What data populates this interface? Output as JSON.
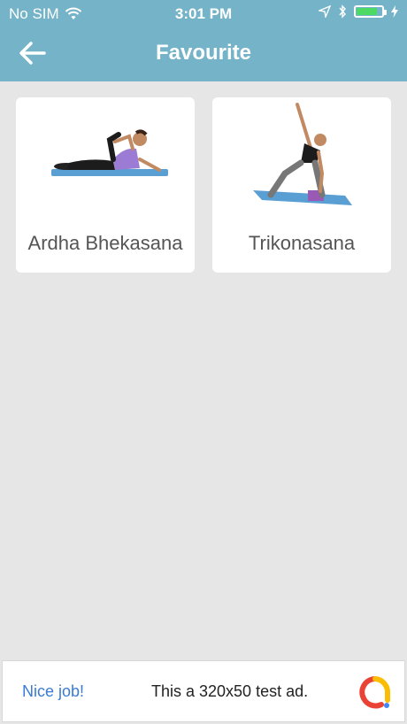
{
  "status": {
    "carrier": "No SIM",
    "time": "3:01 PM"
  },
  "header": {
    "title": "Favourite"
  },
  "favourites": [
    {
      "name": "Ardha Bhekasana",
      "image": "yoga-pose-lying-image"
    },
    {
      "name": "Trikonasana",
      "image": "yoga-pose-triangle-image"
    }
  ],
  "ad": {
    "link_label": "Nice job!",
    "text": "This a 320x50 test ad."
  },
  "colors": {
    "header_bg": "#74b3c8",
    "page_bg": "#e6e6e6",
    "ad_link": "#3a7bd5",
    "mat": "#5a9fd4",
    "battery": "#4cd964"
  }
}
